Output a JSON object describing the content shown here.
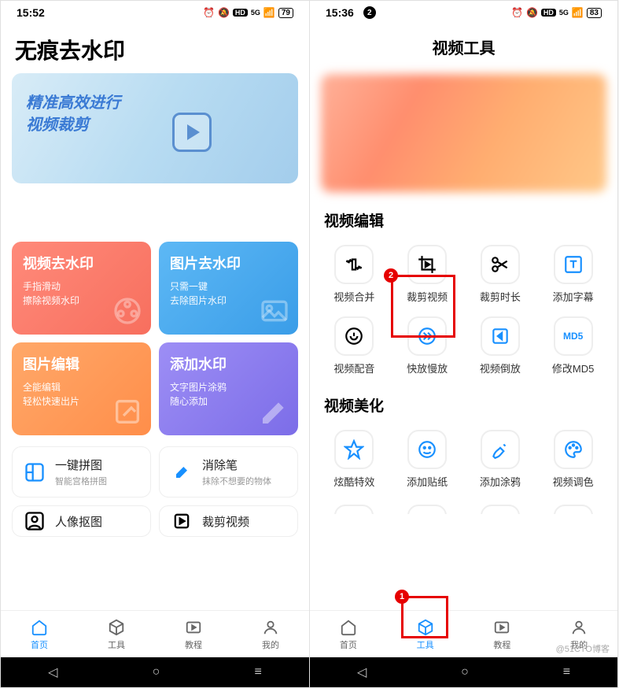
{
  "watermark": "@51CTO博客",
  "screen1": {
    "status": {
      "time": "15:52",
      "hd": "HD",
      "sig": "5G",
      "batt": "79"
    },
    "title": "无痕去水印",
    "banner": {
      "line1": "精准高效进行",
      "line2": "视频裁剪"
    },
    "cards": [
      {
        "title": "视频去水印",
        "sub1": "手指滑动",
        "sub2": "擦除视频水印"
      },
      {
        "title": "图片去水印",
        "sub1": "只需一键",
        "sub2": "去除图片水印"
      },
      {
        "title": "图片编辑",
        "sub1": "全能编辑",
        "sub2": "轻松快速出片"
      },
      {
        "title": "添加水印",
        "sub1": "文字图片涂鸦",
        "sub2": "随心添加"
      }
    ],
    "list": [
      {
        "title": "一键拼图",
        "sub": "智能宫格拼图"
      },
      {
        "title": "消除笔",
        "sub": "抹除不想要的物体"
      },
      {
        "title": "人像抠图",
        "sub": ""
      },
      {
        "title": "裁剪视频",
        "sub": ""
      }
    ],
    "nav": [
      "首页",
      "工具",
      "教程",
      "我的"
    ]
  },
  "screen2": {
    "status": {
      "time": "15:36",
      "dot": "2",
      "hd": "HD",
      "sig": "5G",
      "batt": "83"
    },
    "title": "视频工具",
    "section1": "视频编辑",
    "tools1": [
      "视频合并",
      "裁剪视频",
      "裁剪时长",
      "添加字幕",
      "视频配音",
      "快放慢放",
      "视频倒放",
      "修改MD5"
    ],
    "section2": "视频美化",
    "tools2": [
      "炫酷特效",
      "添加贴纸",
      "添加涂鸦",
      "视频调色"
    ],
    "nav": [
      "首页",
      "工具",
      "教程",
      "我的"
    ],
    "badges": {
      "b1": "1",
      "b2": "2"
    }
  }
}
